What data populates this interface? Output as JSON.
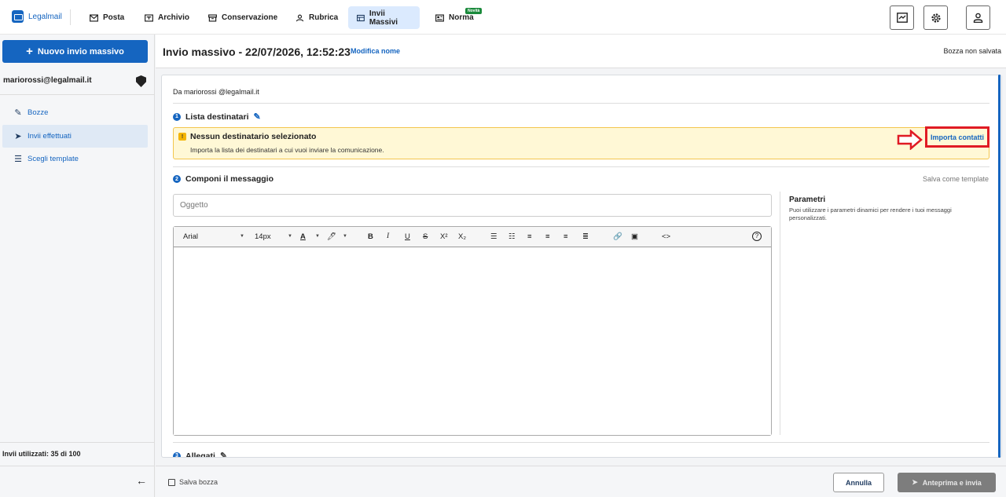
{
  "app": {
    "name": "Legalmail"
  },
  "nav": {
    "items": [
      {
        "label": "Posta",
        "icon": "mail-icon"
      },
      {
        "label": "Archivio",
        "icon": "archive-icon"
      },
      {
        "label": "Conservazione",
        "icon": "box-icon"
      },
      {
        "label": "Rubrica",
        "icon": "contacts-icon"
      },
      {
        "label": "Invii Massivi",
        "icon": "bulk-send-icon",
        "active": true
      },
      {
        "label": "Norma",
        "icon": "norma-icon",
        "badge": "Novità"
      }
    ]
  },
  "sidebar": {
    "new_button": "Nuovo invio massivo",
    "user": "mariorossi@legalmail.it",
    "items": [
      {
        "label": "Bozze",
        "icon": "pencil-icon"
      },
      {
        "label": "Invii effettuati",
        "icon": "send-icon",
        "active": true
      },
      {
        "label": "Scegli template",
        "icon": "template-icon"
      }
    ],
    "usage": "Invii utilizzati: 35 di 100"
  },
  "header": {
    "title": "Invio massivo - 22/07/2026, 12:52:23",
    "rename": "Modifica nome",
    "status": "Bozza non salvata"
  },
  "form": {
    "from_prefix": "Da",
    "from": "mariorossi @legalmail.it",
    "recipients": {
      "step": "1",
      "title": "Lista destinatari",
      "alert_title": "Nessun destinatario selezionato",
      "alert_text": "Importa la lista dei destinatari a cui vuoi inviare la comunicazione.",
      "import": "Importa contatti"
    },
    "compose": {
      "step": "2",
      "title": "Componi il messaggio",
      "save_template": "Salva come template",
      "subject_placeholder": "Oggetto",
      "params_title": "Parametri",
      "params_text": "Puoi utilizzare i parametri dinamici per rendere i tuoi messaggi personalizzati."
    },
    "toolbar": {
      "font": "Arial",
      "size": "14px",
      "text_color": "A",
      "bold": "B",
      "italic": "I",
      "underline": "U",
      "strike": "S",
      "superscript": "X²",
      "subscript": "X₂",
      "code": "<>",
      "help": "?"
    },
    "attachments": {
      "step": "3",
      "title": "Allegati"
    }
  },
  "footer": {
    "save_draft": "Salva bozza",
    "cancel": "Annulla",
    "preview": "Anteprima e invia"
  },
  "colors": {
    "primary": "#1565c0",
    "alert_bg": "#fff8d6",
    "alert_border": "#f3c64d",
    "highlight": "#e01b24"
  }
}
